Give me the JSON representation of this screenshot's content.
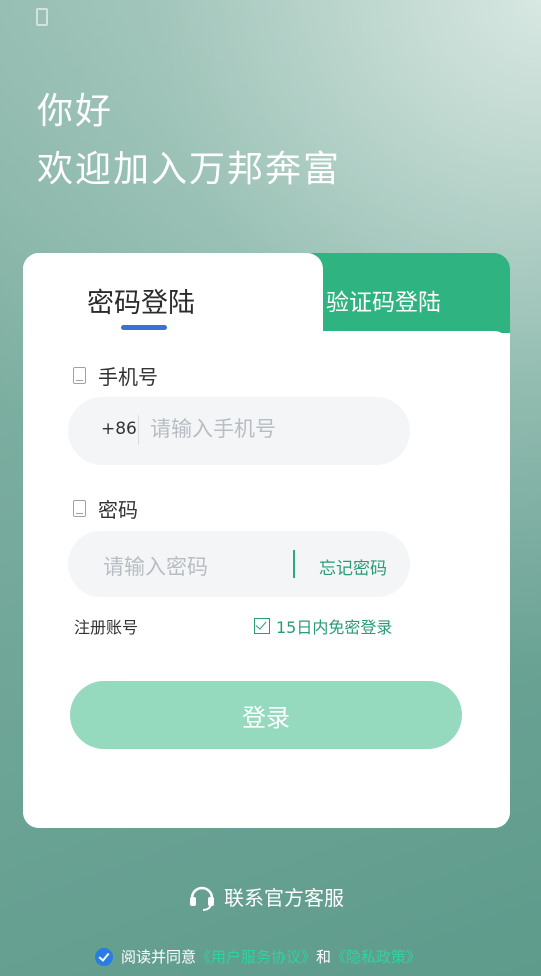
{
  "greeting": {
    "line1": "你好",
    "line2": "欢迎加入万邦奔富"
  },
  "tabs": {
    "active_label": "密码登陆",
    "inactive_label": "验证码登陆"
  },
  "phone_field": {
    "label": "手机号",
    "prefix": "+86",
    "placeholder": "请输入手机号"
  },
  "password_field": {
    "label": "密码",
    "placeholder": "请输入密码",
    "forgot_label": "忘记密码"
  },
  "links": {
    "register": "注册账号",
    "remember": "15日内免密登录"
  },
  "login_button": "登录",
  "support_label": "联系官方客服",
  "agreement": {
    "prefix": "阅读并同意",
    "terms": "《用户服务协议》",
    "and": "和",
    "privacy": "《隐私政策》"
  },
  "colors": {
    "accent_green": "#2fb380",
    "tab_indicator": "#3d6fd8",
    "button_bg": "#95d9bf",
    "link_green": "#2a9b76"
  },
  "icons": {
    "phone": "phone-icon",
    "lock": "lock-icon",
    "checkbox": "checkbox-icon",
    "headset": "headset-icon",
    "agree_check": "check-circle-icon"
  }
}
